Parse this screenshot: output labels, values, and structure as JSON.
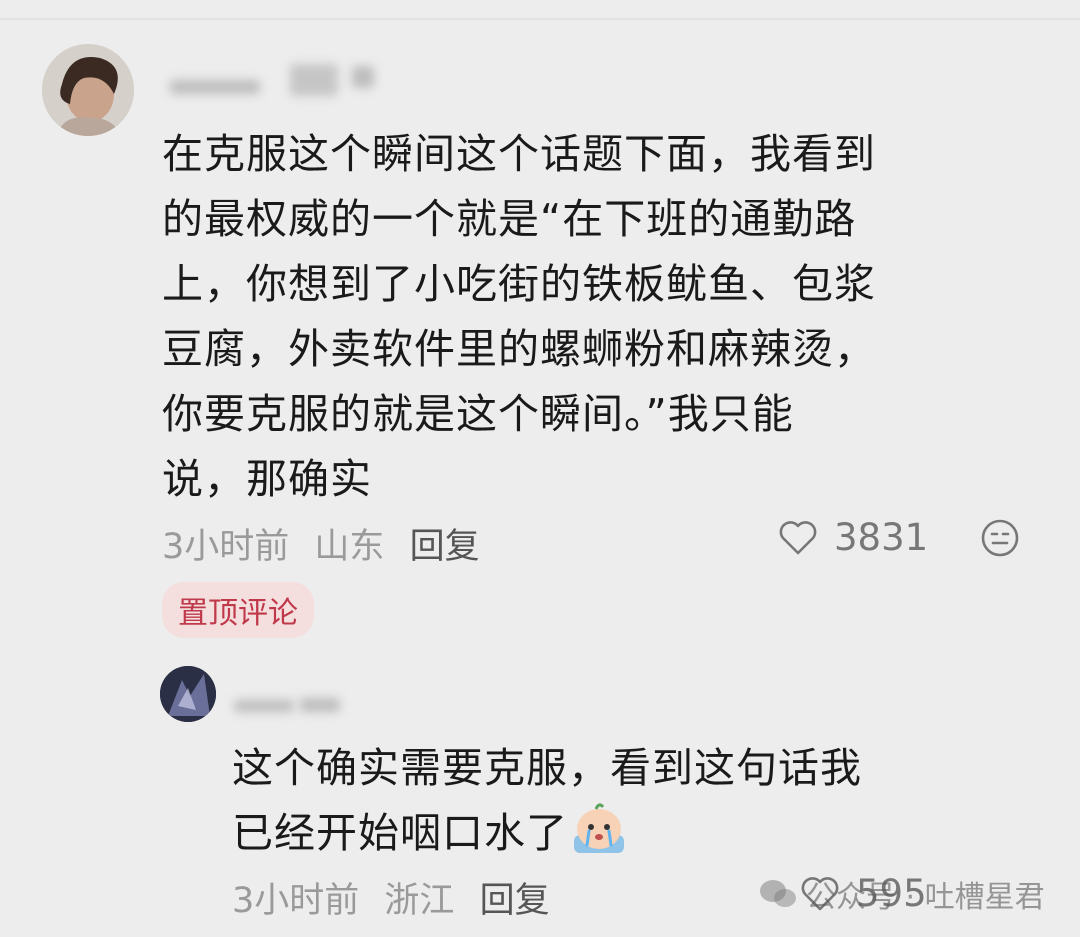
{
  "comment1": {
    "text": "在克服这个瞬间这个话题下面，我看到\n的最权威的一个就是“在下班的通勤路\n上，你想到了小吃街的铁板鱿鱼、包浆\n豆腐，外卖软件里的螺蛳粉和麻辣烫，\n你要克服的就是这个瞬间。”我只能\n说，那确实",
    "time": "3小时前",
    "location": "山东",
    "reply": "回复",
    "likes": "3831",
    "badge": "置顶评论"
  },
  "comment2": {
    "text": "这个确实需要克服，看到这句话我\n已经开始咽口水了",
    "time": "3小时前",
    "location": "浙江",
    "reply": "回复",
    "likes": "595"
  },
  "watermark": {
    "label": "公众号 · 吐槽星君"
  },
  "icons": {
    "like": "heart-outline-icon",
    "more": "face-icon",
    "emoji": "crying-emoji-icon",
    "watermark": "wechat-icon"
  },
  "colors": {
    "background": "#ededed",
    "badge_bg": "#f4dede",
    "badge_text": "#c0394b"
  }
}
